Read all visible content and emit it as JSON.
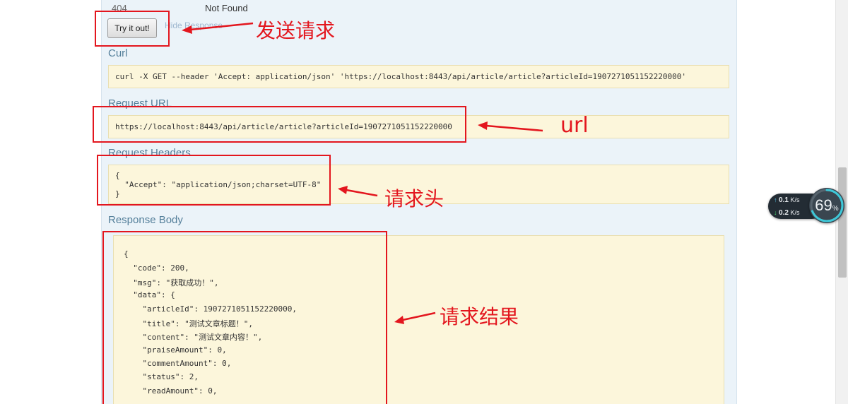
{
  "response_code": {
    "code": "404",
    "description": "Not Found"
  },
  "actions": {
    "try_it_out": "Try it out!",
    "hide_response": "Hide Response"
  },
  "curl": {
    "heading": "Curl",
    "command": "curl -X GET --header 'Accept: application/json' 'https://localhost:8443/api/article/article?articleId=1907271051152220000'"
  },
  "request_url": {
    "heading": "Request URL",
    "value": "https://localhost:8443/api/article/article?articleId=1907271051152220000"
  },
  "request_headers": {
    "heading": "Request Headers",
    "lines": [
      "{",
      "  \"Accept\": \"application/json;charset=UTF-8\"",
      "}"
    ]
  },
  "response_body": {
    "heading": "Response Body",
    "lines": [
      "{",
      "  \"code\": 200,",
      "  \"msg\": \"获取成功！\",",
      "  \"data\": {",
      "    \"articleId\": 1907271051152220000,",
      "    \"title\": \"测试文章标题！\",",
      "    \"content\": \"测试文章内容！\",",
      "    \"praiseAmount\": 0,",
      "    \"commentAmount\": 0,",
      "    \"status\": 2,",
      "    \"readAmount\": 0,"
    ]
  },
  "annotations": {
    "send_request": "发送请求",
    "url": "url",
    "request_headers": "请求头",
    "request_result": "请求结果",
    "color": "#e3161e"
  },
  "net_monitor": {
    "upload_value": "0.1",
    "upload_unit": "K/s",
    "download_value": "0.2",
    "download_unit": "K/s",
    "percent": "69",
    "percent_unit": "%"
  }
}
